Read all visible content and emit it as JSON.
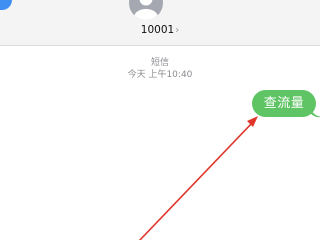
{
  "header": {
    "contact_name": "10001",
    "chevron": "›",
    "avatar_icon": "person-silhouette-icon"
  },
  "thread": {
    "service_label": "短信",
    "timestamp": "今天 上午10:40"
  },
  "messages": [
    {
      "text": "查流量",
      "direction": "outgoing",
      "color": "#5fc464"
    }
  ],
  "annotation": {
    "type": "red-arrow",
    "color": "#e0372c",
    "points_to": "outgoing message bubble"
  },
  "colors": {
    "header_bg": "#f4f4f5",
    "accent_blue": "#3f8ff2",
    "bubble_green": "#5fc464"
  }
}
